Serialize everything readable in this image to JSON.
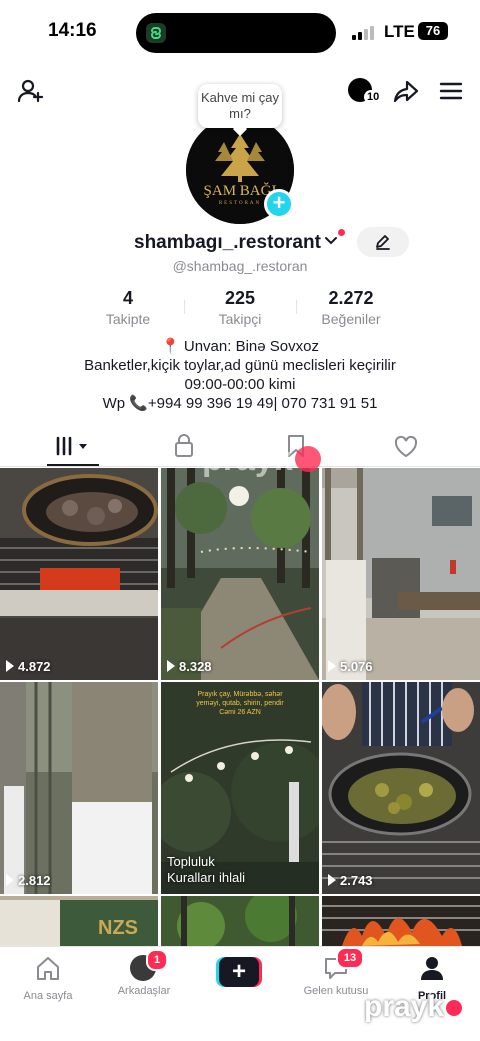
{
  "status_bar": {
    "time": "14:16",
    "network": "LTE",
    "battery": "76"
  },
  "header": {
    "coins_count": "10"
  },
  "profile": {
    "avatar_logo_text": "ŞAM BAĞI",
    "avatar_logo_sub": "RESTORAN",
    "bubble_text": "Kahve mi çay mı?",
    "username": "shambagı_.restorant",
    "handle": "@shambag_.restoran",
    "stats": [
      {
        "value": "4",
        "label": "Takipte"
      },
      {
        "value": "225",
        "label": "Takipçi"
      },
      {
        "value": "2.272",
        "label": "Beğeniler"
      }
    ],
    "bio": [
      "📍 Unvan: Binə Sovxoz",
      "Banketler,kiçik toylar,ad günü meclisleri keçirilir",
      "09:00-00:00 kimi",
      "Wp 📞+994 99 396 19 49| 070 731 91 51"
    ]
  },
  "tabs": [
    "videos-tab",
    "private-tab",
    "saved-tab",
    "liked-tab"
  ],
  "videos": [
    {
      "views": "4.872",
      "theme": "grill"
    },
    {
      "views": "8.328",
      "theme": "garden"
    },
    {
      "views": "5.076",
      "theme": "yard"
    },
    {
      "views": "2.812",
      "theme": "trees"
    },
    {
      "violation": "Topluluk\nKuralları ihlali",
      "overlay": "Prayık çay, Mürəbbə, səhər\nyeməyi, qutab, shirin, pendir\nCəmi 26 AZN",
      "theme": "night"
    },
    {
      "views": "2.743",
      "theme": "cooking"
    },
    {
      "theme": "sign"
    },
    {
      "theme": "green"
    },
    {
      "theme": "fire"
    }
  ],
  "watermark": "prayk",
  "nav": {
    "home": "Ana sayfa",
    "friends": "Arkadaşlar",
    "friends_badge": "1",
    "inbox": "Gelen kutusu",
    "inbox_badge": "13",
    "profile": "Profil"
  },
  "colors": {
    "accent": "#fe2c55",
    "cyan": "#20d5ec",
    "text": "#161823",
    "muted": "#8a8b91"
  }
}
